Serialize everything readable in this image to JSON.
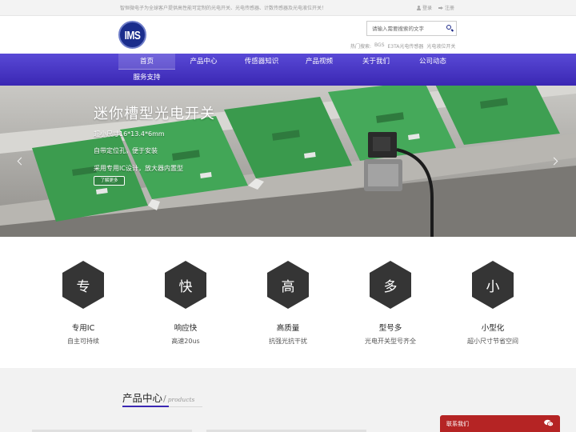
{
  "topbar": {
    "message": "智恒微电子为全球客户提供高性能可定制的光电开关、光电传感器、计数传感器及光电液位开关！",
    "login": "登录",
    "register": "注册"
  },
  "header": {
    "logo_text": "IMS",
    "search_placeholder": "请输入需要搜索的文字",
    "hot_label": "热门搜索:",
    "hot_words": [
      "BGS",
      "E3TA光电传感器",
      "光电液位开关"
    ]
  },
  "nav": {
    "items": [
      "首页",
      "产品中心",
      "传感器知识",
      "产品视频",
      "关于我们",
      "公司动态",
      "服务支持"
    ],
    "active_index": 0
  },
  "hero": {
    "title": "迷你槽型光电开关",
    "lines": [
      "超小尺寸16*13.4*6mm",
      "自带定位孔，便于安装",
      "采用专用IC设计，放大器内置型"
    ],
    "more_button": "了解更多"
  },
  "features": [
    {
      "icon_char": "专",
      "title": "专用IC",
      "subtitle": "自主可持续"
    },
    {
      "icon_char": "快",
      "title": "响应快",
      "subtitle": "高速20us"
    },
    {
      "icon_char": "高",
      "title": "高质量",
      "subtitle": "抗强光抗干扰"
    },
    {
      "icon_char": "多",
      "title": "型号多",
      "subtitle": "光电开关型号齐全"
    },
    {
      "icon_char": "小",
      "title": "小型化",
      "subtitle": "超小尺寸节省空间"
    }
  ],
  "products": {
    "heading": "产品中心",
    "slash": "/",
    "heading_en": "products"
  },
  "contact": {
    "label": "联系我们",
    "icon": "chat-bubbles-icon"
  },
  "colors": {
    "nav_top": "#5949d6",
    "nav_bottom": "#3a27b3",
    "logo": "#1a2d8c",
    "hex": "#353535",
    "contact": "#b52424"
  }
}
